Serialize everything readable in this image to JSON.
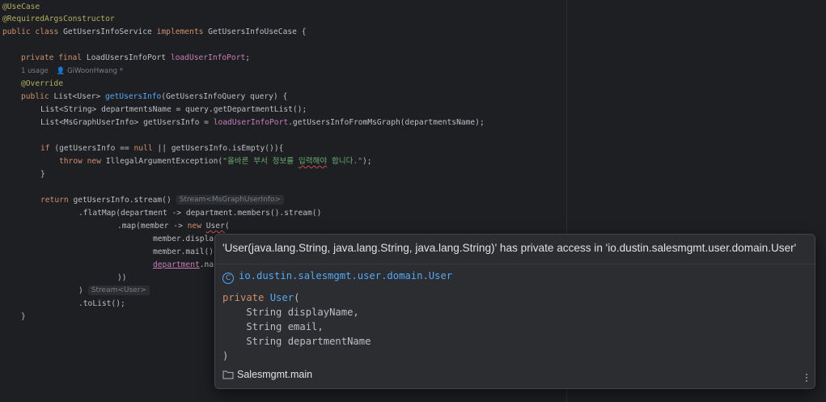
{
  "code": {
    "annotation_usecase": "@UseCase",
    "annotation_ctor": "@RequiredArgsConstructor",
    "class_kw": "public class ",
    "class_name": "GetUsersInfoService ",
    "implements_kw": "implements ",
    "interface_name": "GetUsersInfoUseCase {",
    "field_mods": "private final ",
    "field_type": "LoadUsersInfoPort ",
    "field_name": "loadUserInfoPort",
    "field_end": ";",
    "usage_count": "1 usage",
    "usage_author": "GiWoonHwang *",
    "override": "@Override",
    "method_kw": "public ",
    "method_type": "List<User> ",
    "method_name": "getUsersInfo",
    "method_params": "(GetUsersInfoQuery query) {",
    "line_dept": "List<String> departmentsName = query.getDepartmentList();",
    "line_ms_a": "List<MsGraphUserInfo> getUsersInfo = ",
    "line_ms_b": "loadUserInfoPort",
    "line_ms_c": ".getUsersInfoFromMsGraph(departmentsName);",
    "if_kw": "if ",
    "if_a": "(getUsersInfo == ",
    "null_kw": "null",
    "if_b": " || getUsersInfo.isEmpty()){",
    "throw_kw": "throw ",
    "new_kw": "new ",
    "throw_a": "IllegalArgumentException(",
    "throw_str_a": "\"올바른 부서 정보를 ",
    "throw_str_b": "입력해야",
    "throw_str_c": " 합니다.\"",
    "throw_end": ");",
    "close_brace": "}",
    "return_kw": "return ",
    "return_a": "getUsersInfo.stream()",
    "hint_stream_ms": "Stream<MsGraphUserInfo>",
    "flatmap": ".flatMap(department -> department.members().stream()",
    "map_a": ".map(member -> ",
    "map_new": "new ",
    "map_user": "User",
    "map_paren": "(",
    "arg1": "member.displa",
    "arg2": "member.mail()",
    "arg3_a": "department",
    "arg3_b": ".na",
    "close_map": "))",
    "close_flat": ")",
    "hint_stream_user": "Stream<User>",
    "tolist": ".toList();",
    "final_brace": "}"
  },
  "popup": {
    "error": "'User(java.lang.String, java.lang.String, java.lang.String)' has private access in 'io.dustin.salesmgmt.user.domain.User'",
    "class_icon": "C",
    "class_fqn": "io.dustin.salesmgmt.user.domain.User",
    "sig_kw": "private ",
    "sig_name": "User",
    "sig_open": "(",
    "param1": "    String displayName,",
    "param2": "    String email,",
    "param3": "    String departmentName",
    "sig_close": ")",
    "module": "Salesmgmt.main"
  },
  "colors": {
    "background": "#1e1f22",
    "keyword": "#cf8e6d",
    "function": "#56a8f5",
    "field": "#c77dbb",
    "string": "#6aab73",
    "annotation": "#b3ae60",
    "popup_bg": "#2b2d30"
  }
}
